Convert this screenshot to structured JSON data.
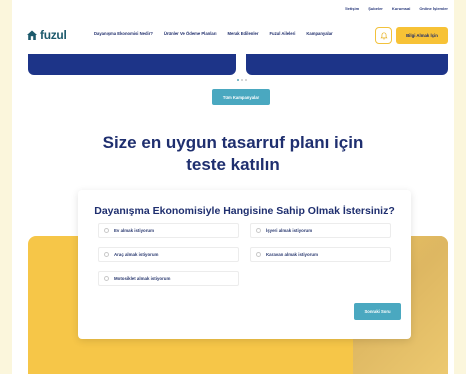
{
  "topbar": {
    "links": [
      "İletişim",
      "Şubeler",
      "Kurumsal",
      "Online İşlemler"
    ]
  },
  "header": {
    "logo_text": "fuzul",
    "nav": [
      "Dayanışma Ekonomisi Nedir?",
      "Ürünler Ve Ödeme Planları",
      "Merak Edilenler",
      "Fuzul Aileleri",
      "Kampanyalar"
    ],
    "cta_label": "Bilgi Almak İçin"
  },
  "carousel": {
    "button_label": "Tüm Kampanyalar"
  },
  "headline": {
    "line1": "Size en uygun tasarruf planı için",
    "line2": "teste katılın"
  },
  "quiz": {
    "title": "Dayanışma Ekonomisiyle Hangisine Sahip Olmak İstersiniz?",
    "options": [
      "Ev almak istiyorum",
      "İşyeri almak istiyorum",
      "Araç almak istiyorum",
      "Karavan almak istiyorum",
      "Motosiklet almak istiyorum"
    ],
    "next_label": "Sonraki Soru"
  },
  "colors": {
    "brand_blue": "#1d3488",
    "accent_yellow": "#f7c236",
    "teal": "#4aa8c0",
    "logo_teal": "#1d5a6c"
  }
}
